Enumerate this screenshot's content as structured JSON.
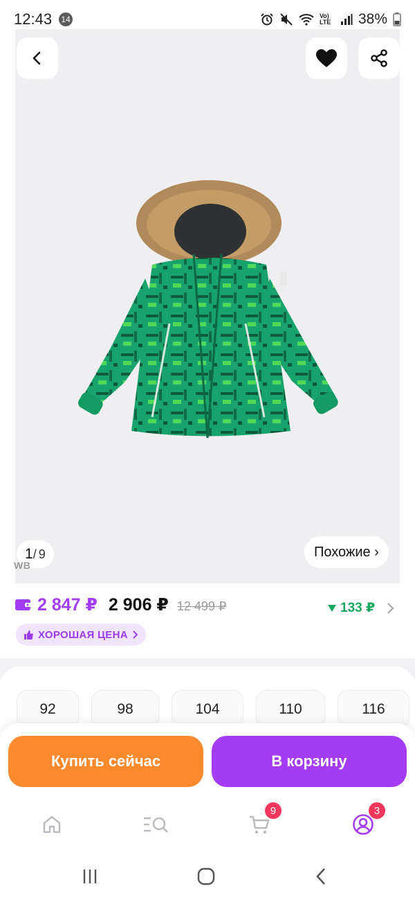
{
  "status_bar": {
    "time": "12:43",
    "notification_count": "14",
    "battery": "38%",
    "network": "Vo) LTE"
  },
  "gallery": {
    "current": "1",
    "separator": "/",
    "total": "9",
    "watermark": "WB",
    "similar_label": "Похожие ›"
  },
  "price": {
    "wallet_price": "2 847 ₽",
    "main_price": "2 906 ₽",
    "old_price": "12 499 ₽",
    "drop_amount": "133 ₽",
    "good_price_label": "ХОРОШАЯ ЦЕНА",
    "accent_color": "#a43cf5",
    "drop_color": "#1aa860"
  },
  "sizes": [
    "92",
    "98",
    "104",
    "110",
    "116"
  ],
  "actions": {
    "buy_now": "Купить сейчас",
    "add_to_cart": "В корзину",
    "buy_color": "#ff8a2e",
    "cart_color": "#a43cf5"
  },
  "bottom_nav": {
    "items": [
      {
        "icon": "home-icon"
      },
      {
        "icon": "catalog-search-icon"
      },
      {
        "icon": "cart-icon",
        "badge": "9"
      },
      {
        "icon": "profile-icon",
        "badge": "3"
      }
    ]
  },
  "system_nav": [
    "recents-icon",
    "home-circle-icon",
    "back-chevron-icon"
  ]
}
